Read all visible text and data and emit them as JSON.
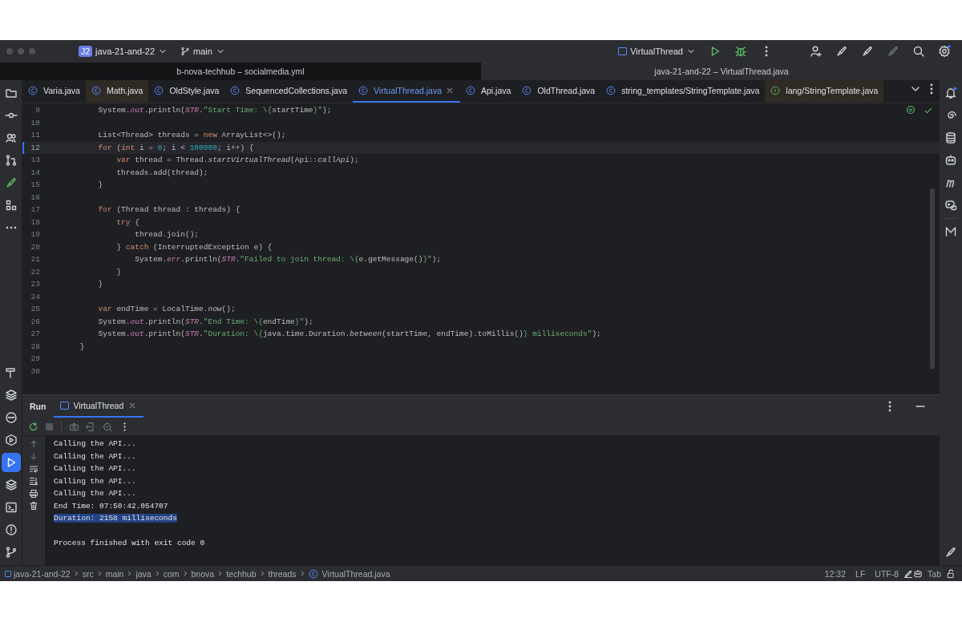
{
  "title_bar": {
    "project_badge": "J2",
    "project": "java-21-and-22",
    "branch": "main",
    "run_config": "VirtualThread"
  },
  "window_titles": [
    {
      "text": "b-nova-techhub – socialmedia.yml",
      "selected": false
    },
    {
      "text": "java-21-and-22 – VirtualThread.java",
      "selected": true
    }
  ],
  "editor_tabs": [
    {
      "label": "Varia.java",
      "kind": "class",
      "selected": false,
      "highlighted": false
    },
    {
      "label": "Math.java",
      "kind": "class",
      "selected": false,
      "highlighted": true
    },
    {
      "label": "OldStyle.java",
      "kind": "class",
      "selected": false,
      "highlighted": false
    },
    {
      "label": "SequencedCollections.java",
      "kind": "class",
      "selected": false,
      "highlighted": false
    },
    {
      "label": "VirtualThread.java",
      "kind": "class",
      "selected": true,
      "highlighted": false
    },
    {
      "label": "Api.java",
      "kind": "class",
      "selected": false,
      "highlighted": false
    },
    {
      "label": "OldThread.java",
      "kind": "class",
      "selected": false,
      "highlighted": false
    },
    {
      "label": "string_templates/StringTemplate.java",
      "kind": "class",
      "selected": false,
      "highlighted": false
    },
    {
      "label": "lang/StringTemplate.java",
      "kind": "interface",
      "selected": false,
      "highlighted": true
    }
  ],
  "editor": {
    "lines": [
      {
        "number": "9",
        "current": false,
        "tokens": [
          {
            "kind": "plain",
            "text": "        System."
          },
          {
            "kind": "static",
            "text": "out"
          },
          {
            "kind": "plain",
            "text": ".println("
          },
          {
            "kind": "static",
            "text": "STR"
          },
          {
            "kind": "plain",
            "text": "."
          },
          {
            "kind": "string",
            "text": "\"Start Time: \\{"
          },
          {
            "kind": "plain",
            "text": "startTime"
          },
          {
            "kind": "string",
            "text": "}\""
          },
          {
            "kind": "plain",
            "text": ");"
          }
        ]
      },
      {
        "number": "10",
        "current": false
      },
      {
        "number": "11",
        "current": false,
        "tokens": [
          {
            "kind": "plain",
            "text": "        List<Thread> threads = "
          },
          {
            "kind": "keyword",
            "text": "new"
          },
          {
            "kind": "plain",
            "text": " ArrayList<>();"
          }
        ]
      },
      {
        "number": "12",
        "current": true,
        "tokens": [
          {
            "kind": "keyword",
            "text": "        for"
          },
          {
            "kind": "plain",
            "text": " ("
          },
          {
            "kind": "keyword",
            "text": "int"
          },
          {
            "kind": "plain",
            "text": " i = "
          },
          {
            "kind": "number",
            "text": "0"
          },
          {
            "kind": "plain",
            "text": "; i < "
          },
          {
            "kind": "number",
            "text": "100000"
          },
          {
            "kind": "plain",
            "text": "; i++) {"
          }
        ]
      },
      {
        "number": "13",
        "current": false,
        "tokens": [
          {
            "kind": "keyword",
            "text": "            var"
          },
          {
            "kind": "plain",
            "text": " thread = Thread."
          },
          {
            "kind": "call",
            "text": "startVirtualThread"
          },
          {
            "kind": "plain",
            "text": "(Api::"
          },
          {
            "kind": "call",
            "text": "callApi"
          },
          {
            "kind": "plain",
            "text": ");"
          }
        ]
      },
      {
        "number": "14",
        "current": false,
        "tokens": [
          {
            "kind": "plain",
            "text": "            threads.add(thread);"
          }
        ]
      },
      {
        "number": "15",
        "current": false,
        "tokens": [
          {
            "kind": "plain",
            "text": "        }"
          }
        ]
      },
      {
        "number": "16",
        "current": false
      },
      {
        "number": "17",
        "current": false,
        "tokens": [
          {
            "kind": "keyword",
            "text": "        for"
          },
          {
            "kind": "plain",
            "text": " (Thread thread : threads) {"
          }
        ]
      },
      {
        "number": "18",
        "current": false,
        "tokens": [
          {
            "kind": "keyword",
            "text": "            try"
          },
          {
            "kind": "plain",
            "text": " {"
          }
        ]
      },
      {
        "number": "19",
        "current": false,
        "tokens": [
          {
            "kind": "plain",
            "text": "                thread.join();"
          }
        ]
      },
      {
        "number": "20",
        "current": false,
        "tokens": [
          {
            "kind": "plain",
            "text": "            } "
          },
          {
            "kind": "keyword",
            "text": "catch"
          },
          {
            "kind": "plain",
            "text": " (InterruptedException e) {"
          }
        ]
      },
      {
        "number": "21",
        "current": false,
        "tokens": [
          {
            "kind": "plain",
            "text": "                System."
          },
          {
            "kind": "static",
            "text": "err"
          },
          {
            "kind": "plain",
            "text": ".println("
          },
          {
            "kind": "static",
            "text": "STR"
          },
          {
            "kind": "plain",
            "text": "."
          },
          {
            "kind": "string",
            "text": "\"Failed to join thread: \\{"
          },
          {
            "kind": "plain",
            "text": "e.getMessage()"
          },
          {
            "kind": "string",
            "text": "}\""
          },
          {
            "kind": "plain",
            "text": ");"
          }
        ]
      },
      {
        "number": "22",
        "current": false,
        "tokens": [
          {
            "kind": "plain",
            "text": "            }"
          }
        ]
      },
      {
        "number": "23",
        "current": false,
        "tokens": [
          {
            "kind": "plain",
            "text": "        }"
          }
        ]
      },
      {
        "number": "24",
        "current": false
      },
      {
        "number": "25",
        "current": false,
        "tokens": [
          {
            "kind": "keyword",
            "text": "        var"
          },
          {
            "kind": "plain",
            "text": " endTime = LocalTime."
          },
          {
            "kind": "call",
            "text": "now"
          },
          {
            "kind": "plain",
            "text": "();"
          }
        ]
      },
      {
        "number": "26",
        "current": false,
        "tokens": [
          {
            "kind": "plain",
            "text": "        System."
          },
          {
            "kind": "static",
            "text": "out"
          },
          {
            "kind": "plain",
            "text": ".println("
          },
          {
            "kind": "static",
            "text": "STR"
          },
          {
            "kind": "plain",
            "text": "."
          },
          {
            "kind": "string",
            "text": "\"End Time: \\{"
          },
          {
            "kind": "plain",
            "text": "endTime"
          },
          {
            "kind": "string",
            "text": "}\""
          },
          {
            "kind": "plain",
            "text": ");"
          }
        ]
      },
      {
        "number": "27",
        "current": false,
        "tokens": [
          {
            "kind": "plain",
            "text": "        System."
          },
          {
            "kind": "static",
            "text": "out"
          },
          {
            "kind": "plain",
            "text": ".println("
          },
          {
            "kind": "static",
            "text": "STR"
          },
          {
            "kind": "plain",
            "text": "."
          },
          {
            "kind": "string",
            "text": "\"Duration: \\{"
          },
          {
            "kind": "plain",
            "text": "java.time.Duration."
          },
          {
            "kind": "call",
            "text": "between"
          },
          {
            "kind": "plain",
            "text": "(startTime, endTime).toMillis()"
          },
          {
            "kind": "string",
            "text": "} milliseconds\""
          },
          {
            "kind": "plain",
            "text": ");"
          }
        ]
      },
      {
        "number": "28",
        "current": false,
        "tokens": [
          {
            "kind": "plain",
            "text": "    }"
          }
        ]
      },
      {
        "number": "29",
        "current": false
      },
      {
        "number": "30",
        "current": false
      }
    ]
  },
  "left_toolbar": {
    "bottom": [
      {
        "selected": false
      },
      {
        "selected": false
      },
      {
        "selected": false
      },
      {
        "selected": false
      },
      {
        "selected": true
      },
      {
        "selected": false
      },
      {
        "selected": false
      },
      {
        "selected": false
      },
      {
        "selected": false
      }
    ]
  },
  "run_panel": {
    "title": "Run",
    "tabs": [
      {
        "label": "VirtualThread",
        "selected": true
      }
    ],
    "output": [
      {
        "text": "Calling the API...",
        "selected": false
      },
      {
        "text": "Calling the API...",
        "selected": false
      },
      {
        "text": "Calling the API...",
        "selected": false
      },
      {
        "text": "Calling the API...",
        "selected": false
      },
      {
        "text": "Calling the API...",
        "selected": false
      },
      {
        "text": "End Time: 07:50:42.054707",
        "selected": false
      },
      {
        "text": "Duration: 2158 milliseconds",
        "selected": true
      }
    ],
    "exit_message": "Process finished with exit code 0"
  },
  "breadcrumb": [
    "java-21-and-22",
    "src",
    "main",
    "java",
    "com",
    "bnova",
    "techhub",
    "threads",
    "VirtualThread.java"
  ],
  "status": [
    "12:32",
    "LF",
    "UTF-8",
    "Tab"
  ]
}
